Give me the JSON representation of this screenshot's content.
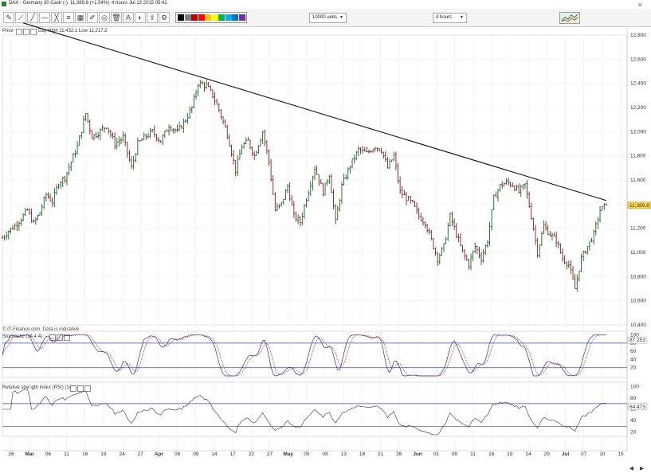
{
  "window": {
    "instrument": "DAX - Germany 30 Cash (-)",
    "price_change": "11,389.8 (+1.54%)",
    "interval": "4 hours",
    "timestamp": "Jul 13 2015 05:42"
  },
  "toolbar": {
    "units_select": "10000 units",
    "timeframe_select": "4 hours",
    "palette_colors": [
      "#000000",
      "#7f7f7f",
      "#c00000",
      "#ff0000",
      "#ffc000",
      "#ffff00",
      "#00b050",
      "#00b0f0",
      "#0070c0",
      "#7030a0"
    ]
  },
  "price_pane": {
    "label": "Price",
    "day_high_low": "Day High 11,432.1 Low 11,217.2",
    "current_price_tag": "11,389.8",
    "copyright": "© IT-Finance.com. Data is indicative"
  },
  "stochastic_pane": {
    "label": "Stochastic (14 4 4)",
    "current_value": "87.253"
  },
  "rsi_pane": {
    "label": "Relative strength index (RSI) (14)",
    "current_value": "64.473"
  },
  "chart_data": [
    {
      "type": "ohlc",
      "pane": "price",
      "x_tick_labels": [
        "26",
        "Mar",
        "06",
        "11",
        "16",
        "19",
        "24",
        "27",
        "Apr",
        "06",
        "09",
        "14",
        "17",
        "22",
        "27",
        "May",
        "05",
        "08",
        "13",
        "18",
        "21",
        "26",
        "Jun",
        "03",
        "08",
        "11",
        "16",
        "19",
        "24",
        "29",
        "Jul",
        "07",
        "10",
        "15"
      ],
      "y_tick_labels": [
        "10,400",
        "10,600",
        "10,800",
        "11,000",
        "11,200",
        "11,400",
        "11,600",
        "11,800",
        "12,000",
        "12,200",
        "12,400",
        "12,600",
        "12,800"
      ],
      "ylim": [
        10400,
        12800
      ],
      "close_path": [
        {
          "x": 0,
          "y": 11120
        },
        {
          "x": 3,
          "y": 11180
        },
        {
          "x": 6,
          "y": 11220
        },
        {
          "x": 9,
          "y": 11280
        },
        {
          "x": 12,
          "y": 11350
        },
        {
          "x": 15,
          "y": 11240
        },
        {
          "x": 18,
          "y": 11330
        },
        {
          "x": 21,
          "y": 11480
        },
        {
          "x": 24,
          "y": 11420
        },
        {
          "x": 27,
          "y": 11580
        },
        {
          "x": 30,
          "y": 11620
        },
        {
          "x": 33,
          "y": 11750
        },
        {
          "x": 36,
          "y": 11880
        },
        {
          "x": 40,
          "y": 12150
        },
        {
          "x": 43,
          "y": 11960
        },
        {
          "x": 46,
          "y": 11990
        },
        {
          "x": 50,
          "y": 12050
        },
        {
          "x": 54,
          "y": 11900
        },
        {
          "x": 58,
          "y": 11950
        },
        {
          "x": 62,
          "y": 11700
        },
        {
          "x": 65,
          "y": 11900
        },
        {
          "x": 68,
          "y": 11950
        },
        {
          "x": 72,
          "y": 12000
        },
        {
          "x": 76,
          "y": 11920
        },
        {
          "x": 80,
          "y": 12050
        },
        {
          "x": 84,
          "y": 12000
        },
        {
          "x": 88,
          "y": 12100
        },
        {
          "x": 91,
          "y": 12200
        },
        {
          "x": 94,
          "y": 12400
        },
        {
          "x": 98,
          "y": 12380
        },
        {
          "x": 101,
          "y": 12300
        },
        {
          "x": 104,
          "y": 12180
        },
        {
          "x": 108,
          "y": 11980
        },
        {
          "x": 112,
          "y": 11680
        },
        {
          "x": 115,
          "y": 11880
        },
        {
          "x": 118,
          "y": 11920
        },
        {
          "x": 121,
          "y": 11800
        },
        {
          "x": 125,
          "y": 12000
        },
        {
          "x": 128,
          "y": 11750
        },
        {
          "x": 131,
          "y": 11350
        },
        {
          "x": 134,
          "y": 11400
        },
        {
          "x": 137,
          "y": 11550
        },
        {
          "x": 140,
          "y": 11300
        },
        {
          "x": 143,
          "y": 11250
        },
        {
          "x": 146,
          "y": 11450
        },
        {
          "x": 150,
          "y": 11700
        },
        {
          "x": 154,
          "y": 11500
        },
        {
          "x": 157,
          "y": 11650
        },
        {
          "x": 160,
          "y": 11250
        },
        {
          "x": 163,
          "y": 11550
        },
        {
          "x": 167,
          "y": 11720
        },
        {
          "x": 171,
          "y": 11850
        },
        {
          "x": 175,
          "y": 11820
        },
        {
          "x": 179,
          "y": 11880
        },
        {
          "x": 182,
          "y": 11850
        },
        {
          "x": 185,
          "y": 11700
        },
        {
          "x": 188,
          "y": 11800
        },
        {
          "x": 191,
          "y": 11500
        },
        {
          "x": 194,
          "y": 11450
        },
        {
          "x": 197,
          "y": 11400
        },
        {
          "x": 200,
          "y": 11300
        },
        {
          "x": 203,
          "y": 11250
        },
        {
          "x": 206,
          "y": 11100
        },
        {
          "x": 209,
          "y": 10950
        },
        {
          "x": 212,
          "y": 11050
        },
        {
          "x": 215,
          "y": 11300
        },
        {
          "x": 218,
          "y": 11150
        },
        {
          "x": 221,
          "y": 11000
        },
        {
          "x": 224,
          "y": 10900
        },
        {
          "x": 227,
          "y": 11050
        },
        {
          "x": 230,
          "y": 10950
        },
        {
          "x": 233,
          "y": 11100
        },
        {
          "x": 236,
          "y": 11450
        },
        {
          "x": 239,
          "y": 11550
        },
        {
          "x": 242,
          "y": 11580
        },
        {
          "x": 245,
          "y": 11560
        },
        {
          "x": 248,
          "y": 11500
        },
        {
          "x": 251,
          "y": 11560
        },
        {
          "x": 254,
          "y": 11300
        },
        {
          "x": 257,
          "y": 11000
        },
        {
          "x": 260,
          "y": 11220
        },
        {
          "x": 263,
          "y": 11150
        },
        {
          "x": 266,
          "y": 11100
        },
        {
          "x": 269,
          "y": 10950
        },
        {
          "x": 272,
          "y": 10900
        },
        {
          "x": 275,
          "y": 10700
        },
        {
          "x": 278,
          "y": 10950
        },
        {
          "x": 281,
          "y": 11050
        },
        {
          "x": 284,
          "y": 11150
        },
        {
          "x": 287,
          "y": 11350
        },
        {
          "x": 290,
          "y": 11389.8
        }
      ],
      "trendline": [
        {
          "x": 10,
          "y": 12900
        },
        {
          "x": 290,
          "y": 11430
        }
      ],
      "last_price": 11389.8
    },
    {
      "type": "line",
      "pane": "stochastic",
      "y_tick_labels": [
        "20",
        "40",
        "60",
        "80",
        "100"
      ],
      "ylim": [
        0,
        105
      ],
      "levels": [
        20,
        80
      ],
      "current_value": 87.253
    },
    {
      "type": "line",
      "pane": "rsi",
      "y_tick_labels": [
        "20",
        "40",
        "60",
        "80",
        "100"
      ],
      "ylim": [
        15,
        105
      ],
      "levels": [
        30,
        70
      ],
      "current_value": 64.473
    }
  ]
}
